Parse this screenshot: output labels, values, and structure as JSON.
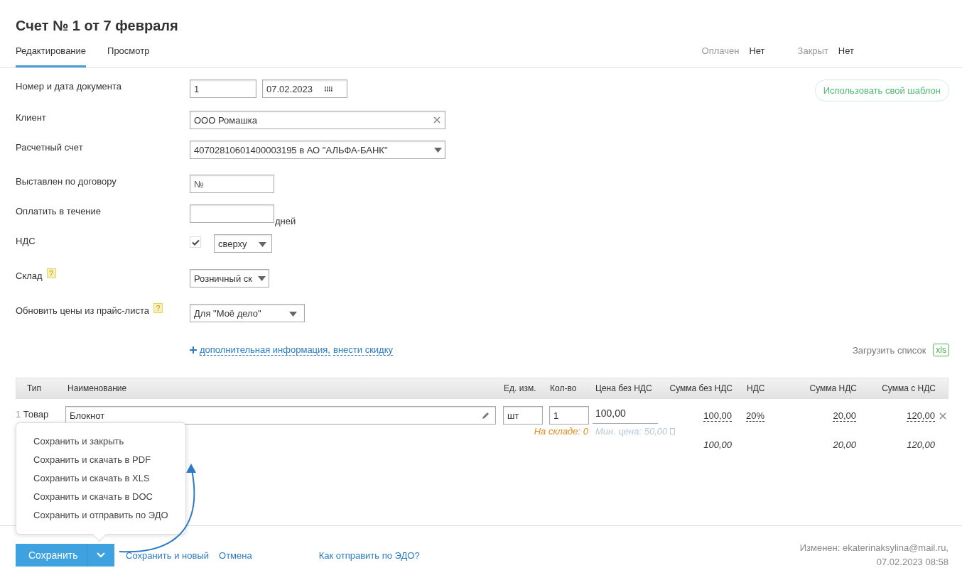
{
  "title": "Счет № 1 от 7 февраля",
  "tabs": [
    {
      "label": "Редактирование",
      "selected": true
    },
    {
      "label": "Просмотр",
      "selected": false
    }
  ],
  "status": [
    {
      "label": "Оплачен",
      "value": "Нет"
    },
    {
      "label": "Закрыт",
      "value": "Нет"
    }
  ],
  "template_button": "Использовать свой шаблон",
  "form": [
    {
      "kind": "number_date",
      "label": "Номер и дата документа",
      "number": "1",
      "date": "07.02.2023"
    },
    {
      "kind": "client",
      "label": "Клиент",
      "value": "ООО Ромашка"
    },
    {
      "kind": "account",
      "label": "Расчетный счет",
      "value": "40702810601400003195 в АО \"АЛЬФА-БАНК\""
    },
    {
      "kind": "contract",
      "label": "Выставлен по договору",
      "value": "№"
    },
    {
      "kind": "days",
      "label": "Оплатить в течение",
      "suffix": "дней"
    },
    {
      "kind": "vat",
      "label": "НДС",
      "checked": true,
      "value": "сверху"
    },
    {
      "kind": "warehouse",
      "label": "Склад",
      "help": "?",
      "value": "Розничный ск"
    },
    {
      "kind": "price_list",
      "label": "Обновить цены из прайс-листа",
      "help": "?",
      "value": "Для \"Моё дело\""
    }
  ],
  "extra_links": [
    "дополнительная информация,",
    "внести скидку"
  ],
  "upload": {
    "label": "Загрузить список",
    "badge": "xls"
  },
  "table": {
    "columns": [
      "Тип",
      "Наименование",
      "Ед. изм.",
      "Кол-во",
      "Цена без НДС",
      "Сумма без НДС",
      "НДС",
      "Сумма НДС",
      "Сумма с НДС"
    ],
    "rows": [
      {
        "index": "1",
        "type": "Товар",
        "name": "Блокнот",
        "unit": "шт",
        "qty": "1",
        "price": "100,00",
        "stock": "На складе: 0",
        "min_price": "Мин. цена: 50,00",
        "sum": "100,00",
        "vat": "20%",
        "vat_sum": "20,00",
        "total": "120,00"
      }
    ],
    "totals": {
      "sum": "100,00",
      "vat_sum": "20,00",
      "total": "120,00"
    }
  },
  "save_menu": [
    "Сохранить и закрыть",
    "Сохранить и скачать в PDF",
    "Сохранить и скачать в XLS",
    "Сохранить и скачать в DOC",
    "Сохранить и отправить по ЭДО"
  ],
  "footer": {
    "save": "Сохранить",
    "links": [
      "Сохранить и новый",
      "Отмена"
    ],
    "help_link": "Как отправить по ЭДО?",
    "modified": "Изменен: ekaterinaksylina@mail.ru,",
    "modified_date": "07.02.2023 08:58"
  }
}
